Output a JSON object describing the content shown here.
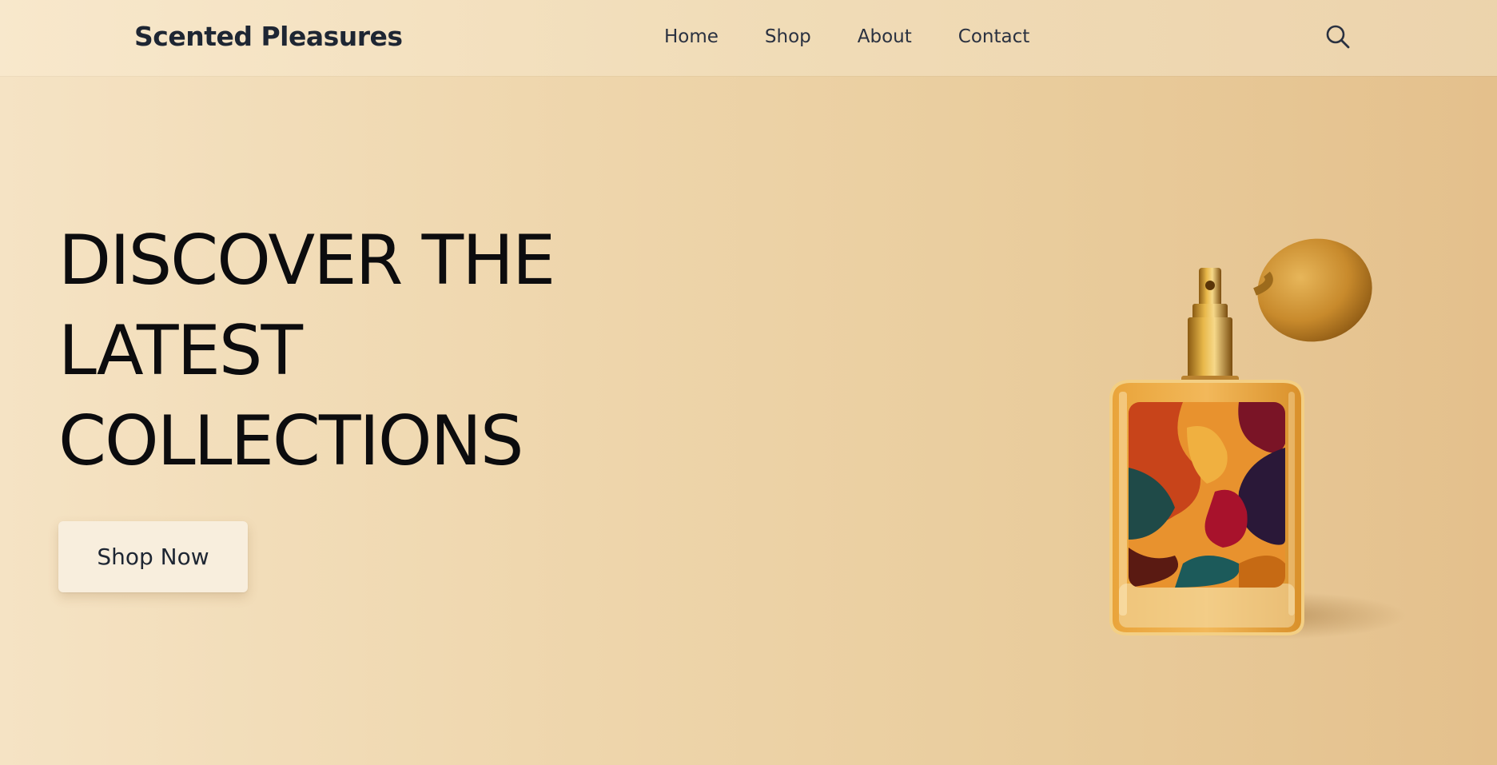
{
  "header": {
    "brand": "Scented Pleasures",
    "nav": [
      {
        "label": "Home"
      },
      {
        "label": "Shop"
      },
      {
        "label": "About"
      },
      {
        "label": "Contact"
      }
    ],
    "search_icon": "search-icon"
  },
  "hero": {
    "title_lines": [
      "DISCOVER THE",
      "LATEST",
      "COLLECTIONS"
    ],
    "cta_label": "Shop Now",
    "image": "perfume-bottle-with-atomizer"
  },
  "colors": {
    "background_light": "#f5e3c4",
    "background_dark": "#e4c08c",
    "text_dark": "#1e2633",
    "button_bg": "#f8eedd"
  }
}
